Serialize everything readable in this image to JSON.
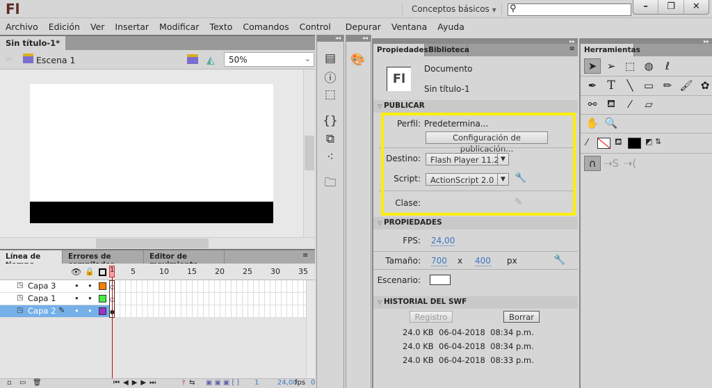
{
  "app": {
    "logo": "Fl",
    "workspace": "Conceptos básicos",
    "search_placeholder": "",
    "window_buttons": [
      "minimize",
      "restore",
      "close"
    ]
  },
  "menu": [
    "Archivo",
    "Edición",
    "Ver",
    "Insertar",
    "Modificar",
    "Texto",
    "Comandos",
    "Control",
    "Depurar",
    "Ventana",
    "Ayuda"
  ],
  "document": {
    "tab": "Sin título-1*",
    "tab_close": "×",
    "scene": "Escena 1",
    "zoom": "50%",
    "stage_color": "#ffffff"
  },
  "timeline": {
    "tabs": [
      "Línea de tiempo",
      "Errores de compilador",
      "Editor de movimiento"
    ],
    "frame_numbers": [
      "1",
      "5",
      "10",
      "15",
      "20",
      "25",
      "30",
      "35"
    ],
    "layers": [
      {
        "name": "Capa 3",
        "color": "#ff7f00",
        "selected": false
      },
      {
        "name": "Capa 1",
        "color": "#44ee44",
        "selected": false
      },
      {
        "name": "Capa 2",
        "color": "#9933cc",
        "selected": true
      }
    ],
    "current_frame": "1",
    "fps": "24,00",
    "fps_unit": "fps",
    "time": "0"
  },
  "properties": {
    "tabs": [
      "Propiedades",
      "Biblioteca"
    ],
    "doc_type": "Documento",
    "doc_name": "Sin título-1",
    "doc_icon": "Fl",
    "publish": {
      "header": "PUBLICAR",
      "profile_label": "Perfil:",
      "profile": "Predetermina...",
      "settings_button": "Configuración de publicación...",
      "target_label": "Destino:",
      "target": "Flash Player 11.2",
      "script_label": "Script:",
      "script": "ActionScript 2.0",
      "class_label": "Clase:"
    },
    "props": {
      "header": "PROPIEDADES",
      "fps_label": "FPS:",
      "fps": "24,00",
      "size_label": "Tamaño:",
      "width": "700",
      "x": "x",
      "height": "400",
      "unit": "px",
      "stage_label": "Escenario:"
    },
    "history": {
      "header": "HISTORIAL DEL SWF",
      "log_button": "Registro",
      "clear_button": "Borrar",
      "entries": [
        {
          "size": "24.0 KB",
          "date": "06-04-2018",
          "time": "08:34 p.m."
        },
        {
          "size": "24.0 KB",
          "date": "06-04-2018",
          "time": "08:34 p.m."
        },
        {
          "size": "24.0 KB",
          "date": "06-04-2018",
          "time": "08:33 p.m."
        }
      ]
    }
  },
  "tools": {
    "title": "Herramientas",
    "highlight_color": "#ffee00"
  }
}
